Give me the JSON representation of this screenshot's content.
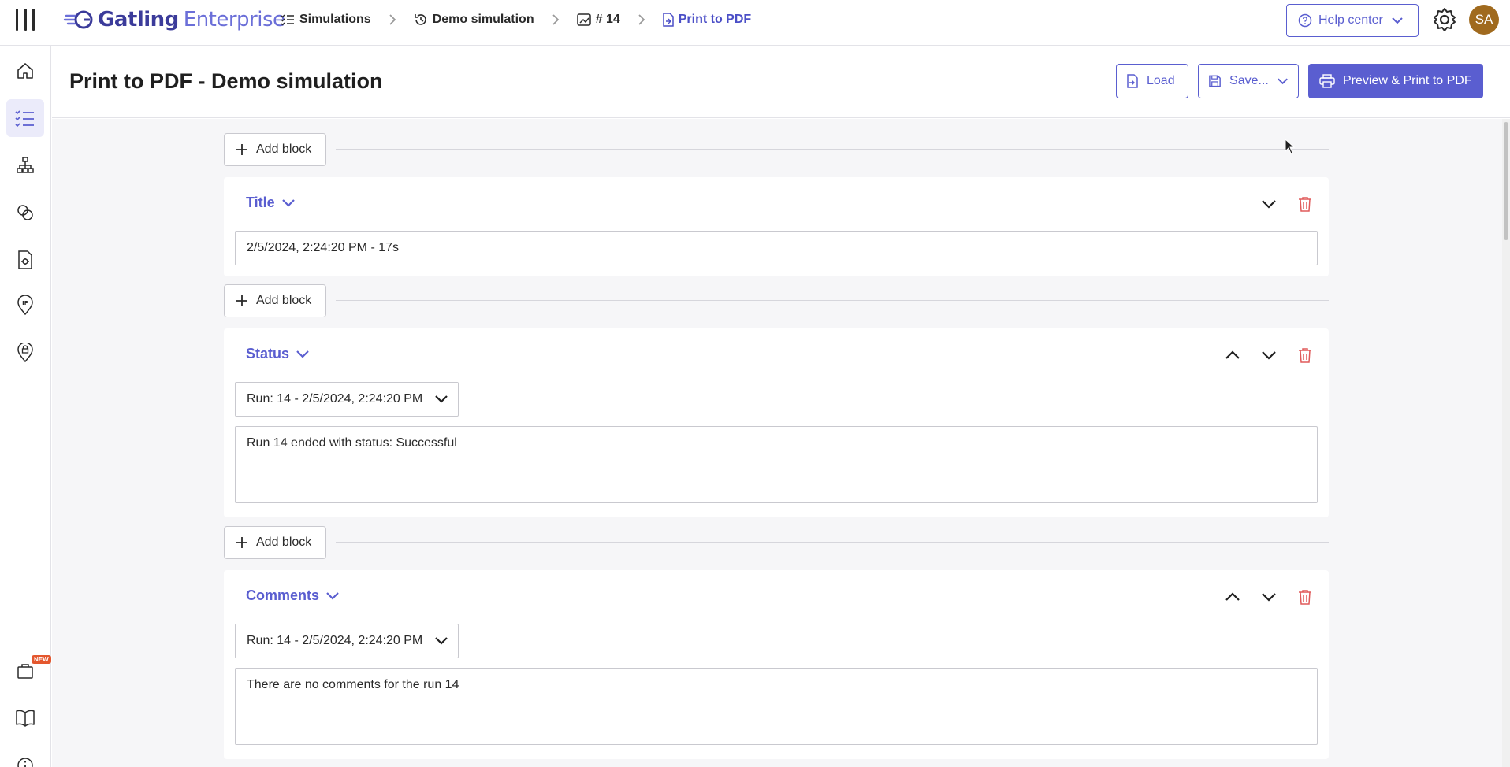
{
  "app": {
    "logo_primary": "Gatling",
    "logo_secondary": "Enterprise"
  },
  "breadcrumbs": [
    {
      "label": "Simulations",
      "icon": "list-icon"
    },
    {
      "label": "Demo simulation",
      "icon": "history-icon"
    },
    {
      "label": "# 14",
      "icon": "report-icon"
    },
    {
      "label": "Print to PDF",
      "icon": "document-icon"
    }
  ],
  "topbar": {
    "help_label": "Help center",
    "avatar_initials": "SA"
  },
  "sidebar": {
    "new_badge": "NEW",
    "items": [
      "home-icon",
      "simulations-icon",
      "teams-icon",
      "packages-icon",
      "private-locations-icon",
      "ip-icon",
      "locations-icon",
      "releases-icon",
      "docs-icon",
      "info-icon"
    ]
  },
  "header": {
    "title": "Print to PDF - Demo simulation",
    "load_label": "Load",
    "save_label": "Save...",
    "preview_label": "Preview & Print to PDF"
  },
  "add_block_label": "Add block",
  "blocks": [
    {
      "type": "Title",
      "value": "2/5/2024, 2:24:20 PM - 17s"
    },
    {
      "type": "Status",
      "run_select": "Run:  14 - 2/5/2024, 2:24:20 PM",
      "text": "Run 14 ended with status: Successful"
    },
    {
      "type": "Comments",
      "run_select": "Run:  14 - 2/5/2024, 2:24:20 PM",
      "text": "There are no comments for the run 14"
    }
  ],
  "colors": {
    "accent": "#5a5ed0",
    "danger": "#e05a5a",
    "avatar": "#a06a1e"
  }
}
